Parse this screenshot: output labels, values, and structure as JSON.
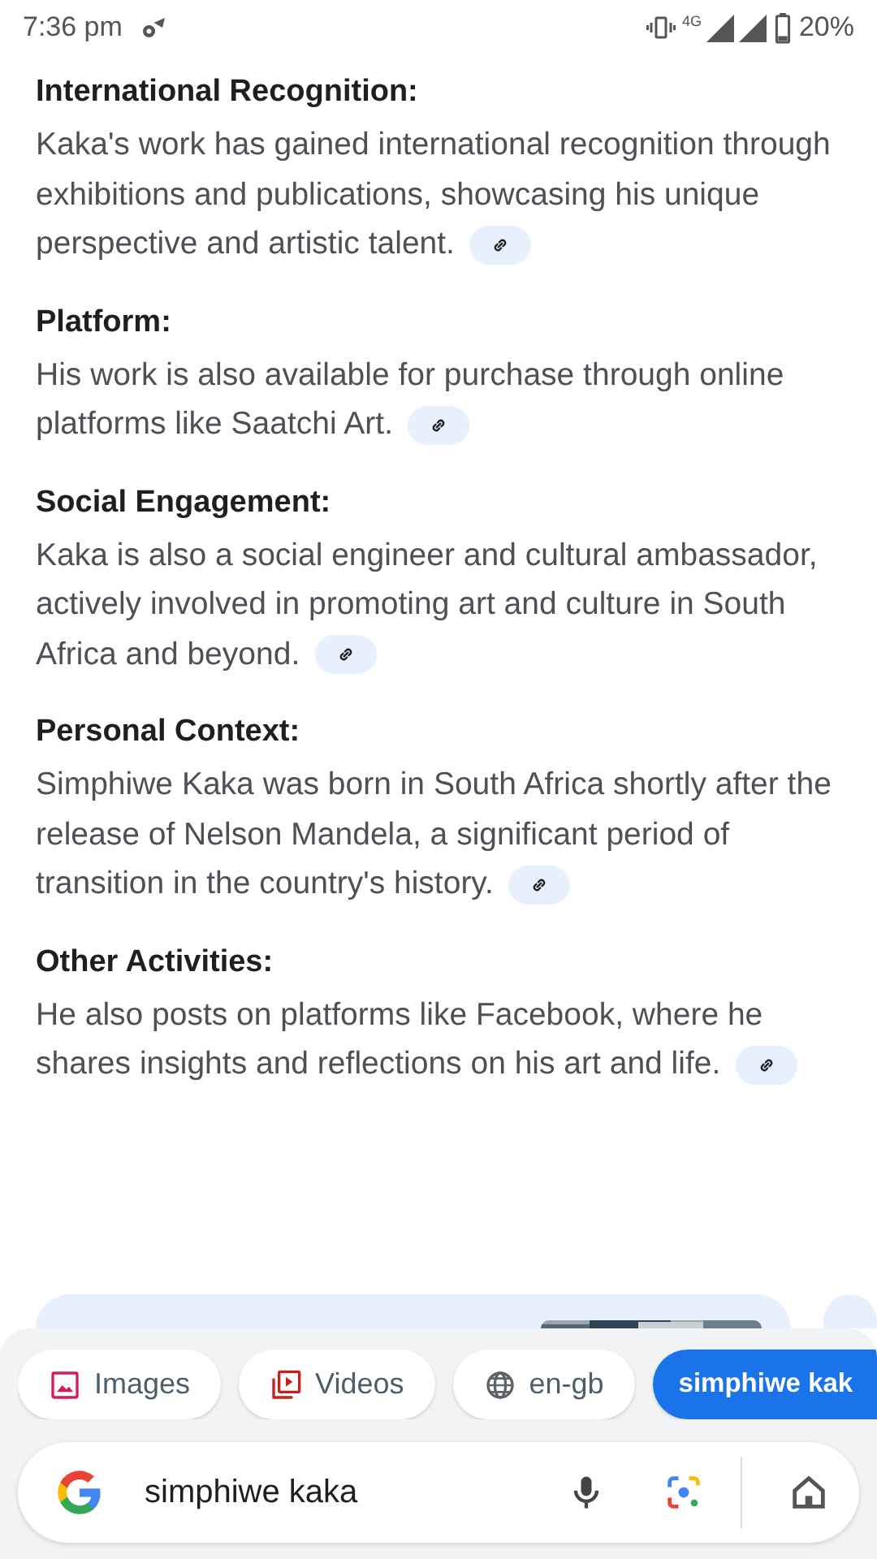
{
  "status_bar": {
    "time": "7:36 pm",
    "network": "4G",
    "battery": "20%"
  },
  "sections": [
    {
      "heading": "International Recognition:",
      "text": "Kaka's work has gained international recognition through exhibitions and publications, showcasing his unique perspective and artistic talent."
    },
    {
      "heading": "Platform:",
      "text": "His work is also available for purchase through online platforms like Saatchi Art."
    },
    {
      "heading": "Social Engagement:",
      "text": "Kaka is also a social engineer and cultural ambassador, actively involved in promoting art and culture in South Africa and beyond."
    },
    {
      "heading": "Personal Context:",
      "text": "Simphiwe Kaka was born in South Africa shortly after the release of Nelson Mandela, a significant period of transition in the country's history."
    },
    {
      "heading": "Other Activities:",
      "text": "He also posts on platforms like Facebook, where he shares insights and reflections on his art and life."
    }
  ],
  "chips": [
    {
      "kind": "images",
      "label": "Images",
      "selected": false
    },
    {
      "kind": "videos",
      "label": "Videos",
      "selected": false
    },
    {
      "kind": "language",
      "label": "en-gb",
      "selected": false
    },
    {
      "kind": "query",
      "label": "simphiwe kak",
      "selected": true
    }
  ],
  "search": {
    "value": "simphiwe kaka"
  }
}
